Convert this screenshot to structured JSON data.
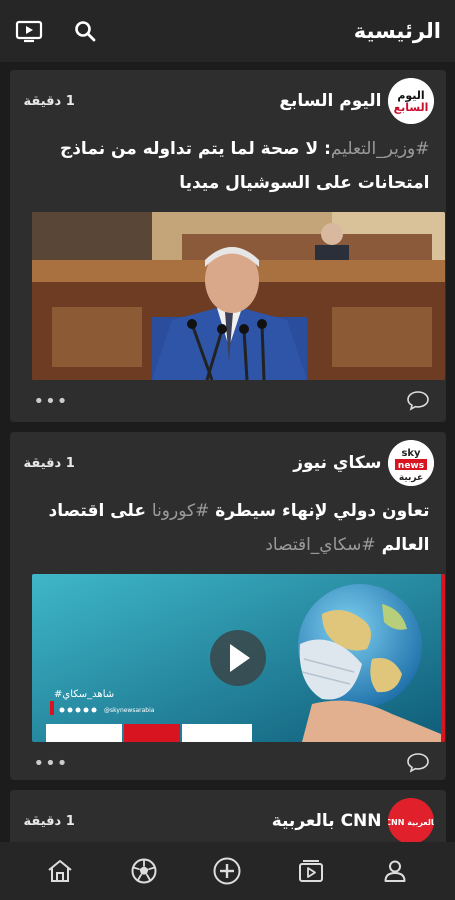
{
  "header": {
    "title": "الرئيسية",
    "icons": [
      "tv-icon",
      "search-icon"
    ]
  },
  "feed": {
    "cards": [
      {
        "source": "اليوم السابع",
        "logo_text_line1": "اليوم",
        "logo_text_line2": "السابع",
        "time": "1 دقيقة",
        "headline_tag": "#وزير_التعليم",
        "headline_rest": ": لا صحة لما يتم تداوله من نماذج امتحانات على السوشيال ميديا",
        "media_type": "photo"
      },
      {
        "source": "سكاي نيوز",
        "logo_text_line1": "sky",
        "logo_text_line2": "news",
        "logo_text_line3": "عربية",
        "time": "1 دقيقة",
        "headline_part1": "تعاون دولي لإنهاء سيطرة ",
        "headline_tag1": "#كورونا",
        "headline_part2": " على اقتصاد العالم ",
        "headline_tag2": "#سكاي_اقتصاد",
        "media_type": "video",
        "video_overlay_hashtag": "#شاهد_سكاي",
        "video_overlay_handle": "@skynewsarabia"
      },
      {
        "source": "CNN بالعربية",
        "logo_text": "بالعربية CNN",
        "time": "1 دقيقة"
      }
    ]
  },
  "bottom_nav": {
    "items": [
      "home-icon",
      "sports-ball-icon",
      "add-circle-icon",
      "video-icon",
      "profile-icon"
    ]
  },
  "colors": {
    "background": "#1c1c1c",
    "card": "#2e2e2e",
    "bar": "#262626",
    "tag_gray": "#9a9a9a",
    "sky_red": "#d7141f",
    "cnn_red": "#e0202a"
  }
}
